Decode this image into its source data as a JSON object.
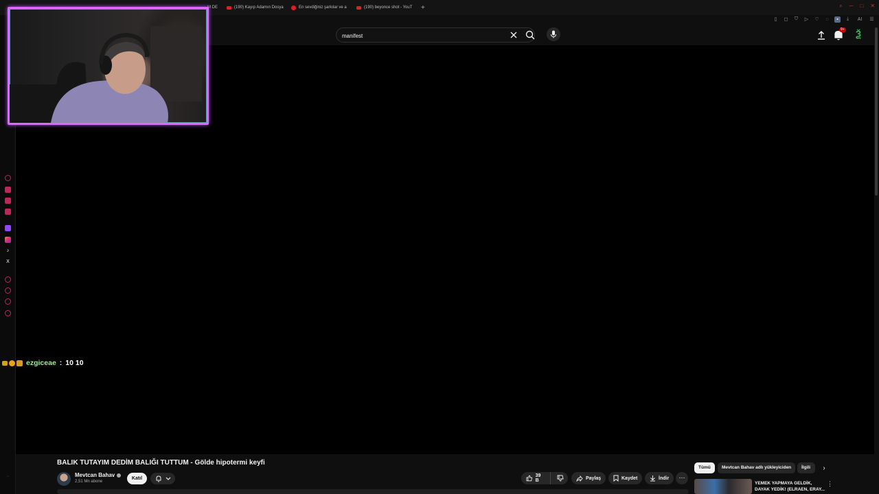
{
  "browser": {
    "tabs": [
      {
        "label": "M DE",
        "icon": "red-dot"
      },
      {
        "label": "(190) Kayıp Adamın Dosya",
        "icon": "youtube-icon"
      },
      {
        "label": "En sevdiğiniz şarkılar ve a",
        "icon": "red-dot"
      },
      {
        "label": "(190) beyonce shot - YouT",
        "icon": "youtube-icon"
      }
    ],
    "new_tab": "+",
    "toolbar_ai_label": "AI"
  },
  "search": {
    "value": "manifest"
  },
  "notifications": {
    "badge": "9+"
  },
  "chat": {
    "user": "ezgiceae",
    "separator": ":",
    "message": "10 10"
  },
  "video": {
    "title": "BALIK TUTAYIM DEDİM BALIĞI TUTTUM - Gölde hipotermi keyfi",
    "channel": "Mevtcan Bahav",
    "subscribers": "2,51 Mn abone",
    "join_label": "Katıl",
    "like_count": "39 B",
    "share_label": "Paylaş",
    "save_label": "Kaydet",
    "download_label": "İndir"
  },
  "chips": {
    "all": "Tümü",
    "uploader": "Mevtcan Bahav adlı yükleyiciden",
    "related": "İlgili"
  },
  "related": {
    "title": "YEMEK YAPMAYA GELDİK, DAYAK YEDİK! (ELRAEN, ERAY..."
  },
  "colors": {
    "webcam_border": "#e067ff",
    "chat_username": "#9bf093",
    "youtube_red": "#e02020"
  }
}
